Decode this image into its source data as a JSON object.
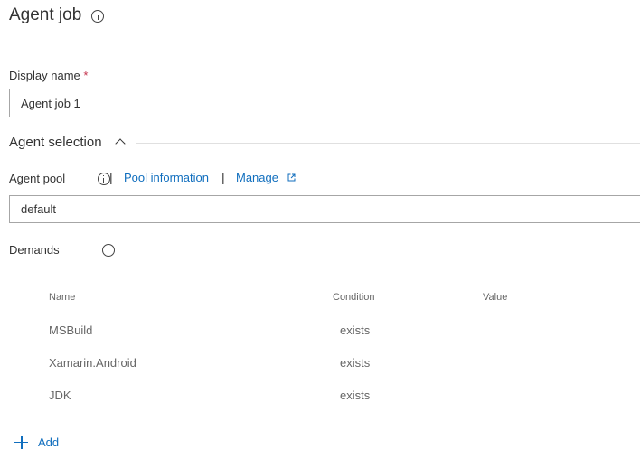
{
  "header": {
    "title": "Agent job"
  },
  "display_name": {
    "label": "Display name",
    "required_marker": "*",
    "value": "Agent job 1"
  },
  "agent_selection": {
    "title": "Agent selection",
    "agent_pool": {
      "label": "Agent pool",
      "separator": "|",
      "pool_information_link": "Pool information",
      "manage_link": "Manage",
      "value": "default"
    }
  },
  "demands": {
    "label": "Demands",
    "columns": [
      "Name",
      "Condition",
      "Value"
    ],
    "rows": [
      {
        "name": "MSBuild",
        "condition": "exists",
        "value": ""
      },
      {
        "name": "Xamarin.Android",
        "condition": "exists",
        "value": ""
      },
      {
        "name": "JDK",
        "condition": "exists",
        "value": ""
      }
    ],
    "add_label": "Add"
  },
  "colors": {
    "link": "#106ebe",
    "required": "#c4314b",
    "text": "#333333",
    "muted_text": "#666666",
    "border": "#a6a6a6"
  },
  "icons": {
    "info": "info-icon",
    "collapse": "chevron-up-icon",
    "external": "external-link-icon",
    "add": "plus-icon"
  }
}
